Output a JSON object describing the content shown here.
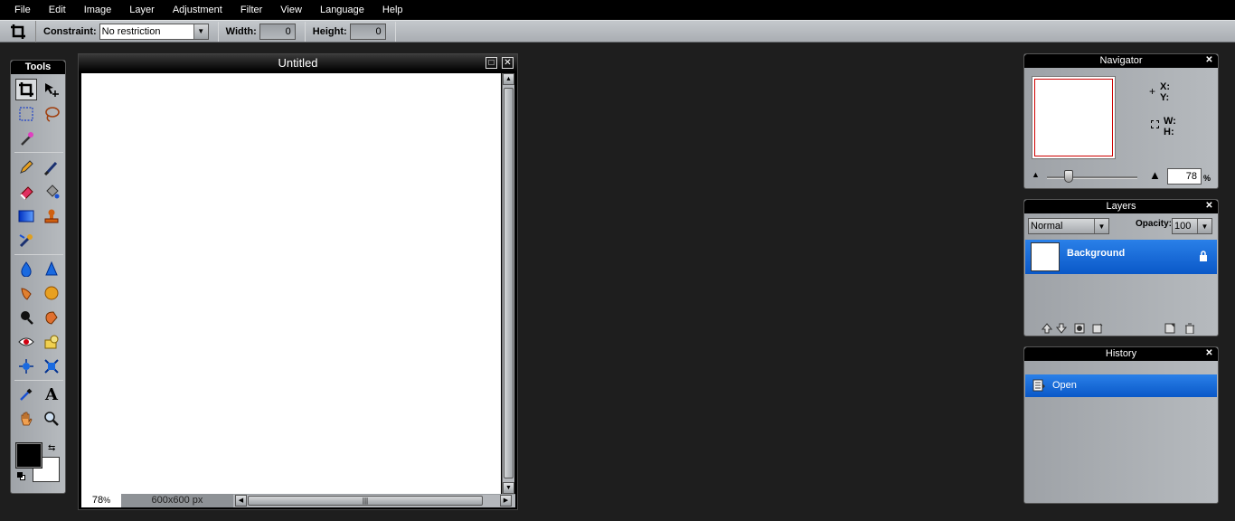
{
  "menu": [
    "File",
    "Edit",
    "Image",
    "Layer",
    "Adjustment",
    "Filter",
    "View",
    "Language",
    "Help"
  ],
  "options": {
    "constraint_label": "Constraint:",
    "constraint_value": "No restriction",
    "width_label": "Width:",
    "width_value": "0",
    "height_label": "Height:",
    "height_value": "0"
  },
  "tools": {
    "title": "Tools",
    "text_tool_glyph": "A",
    "foreground_color": "#000000",
    "background_color": "#ffffff"
  },
  "document": {
    "title": "Untitled",
    "zoom": "78",
    "zoom_unit": "%",
    "size": "600x600 px"
  },
  "navigator": {
    "title": "Navigator",
    "x_label": "X:",
    "y_label": "Y:",
    "w_label": "W:",
    "h_label": "H:",
    "zoom_value": "78",
    "zoom_unit": "%"
  },
  "layers": {
    "title": "Layers",
    "blend_mode": "Normal",
    "opacity_label": "Opacity:",
    "opacity_value": "100",
    "items": [
      {
        "name": "Background",
        "locked": true
      }
    ]
  },
  "history": {
    "title": "History",
    "items": [
      {
        "label": "Open"
      }
    ]
  },
  "colors": {
    "selection_blue": "#1a6ae0"
  }
}
